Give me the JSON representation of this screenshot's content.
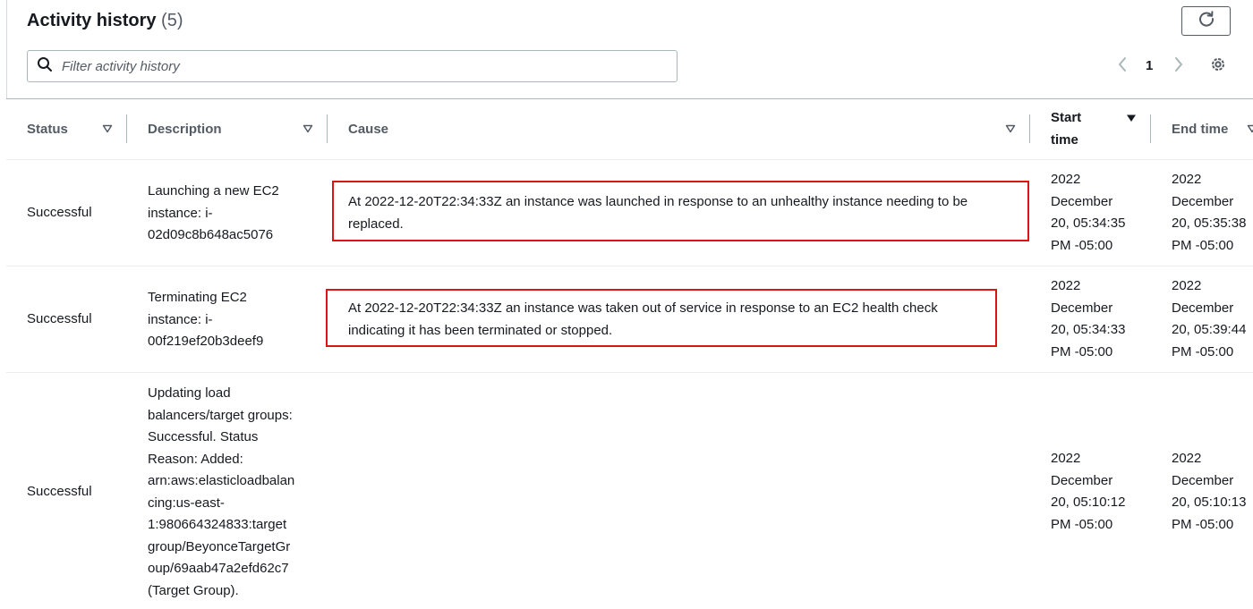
{
  "header": {
    "title": "Activity history",
    "count": "(5)"
  },
  "search": {
    "placeholder": "Filter activity history",
    "value": ""
  },
  "pagination": {
    "current_page": "1"
  },
  "table": {
    "columns": [
      {
        "label": "Status"
      },
      {
        "label": "Description"
      },
      {
        "label": "Cause"
      },
      {
        "label": "Start time",
        "label_lines": [
          "Start",
          "time"
        ]
      },
      {
        "label": "End time"
      }
    ],
    "rows": [
      {
        "status": "Successful",
        "description_lines": [
          "Launching a new EC2",
          "instance: i-",
          "02d09c8b648ac5076"
        ],
        "cause_lines": [
          "At 2022-12-20T22:34:33Z an instance was launched in response to an unhealthy instance needing to be",
          "replaced."
        ],
        "start_lines": [
          "2022",
          "December",
          "20, 05:34:35",
          "PM -05:00"
        ],
        "end_lines": [
          "2022",
          "December",
          "20, 05:35:38",
          "PM -05:00"
        ]
      },
      {
        "status": "Successful",
        "description_lines": [
          "Terminating EC2",
          "instance: i-",
          "00f219ef20b3deef9"
        ],
        "cause_lines": [
          "At 2022-12-20T22:34:33Z an instance was taken out of service in response to an EC2 health check",
          "indicating it has been terminated or stopped."
        ],
        "start_lines": [
          "2022",
          "December",
          "20, 05:34:33",
          "PM -05:00"
        ],
        "end_lines": [
          "2022",
          "December",
          "20, 05:39:44",
          "PM -05:00"
        ]
      },
      {
        "status": "Successful",
        "description_lines": [
          "Updating load",
          "balancers/target groups:",
          "Successful. Status",
          "Reason: Added:",
          "arn:aws:elasticloadbalan",
          "cing:us-east-",
          "1:980664324833:target",
          "group/BeyonceTargetGr",
          "oup/69aab47a2efd62c7",
          "(Target Group)."
        ],
        "cause_lines": [],
        "start_lines": [
          "2022",
          "December",
          "20, 05:10:12",
          "PM -05:00"
        ],
        "end_lines": [
          "2022",
          "December",
          "20, 05:10:13",
          "PM -05:00"
        ]
      }
    ]
  },
  "colors": {
    "highlight_border": "#d91515",
    "text": "#16191f",
    "muted": "#545b64"
  },
  "icons": [
    "refresh-icon",
    "search-icon",
    "chevron-left-icon",
    "chevron-right-icon",
    "settings-gear-icon",
    "filter-caret-icon",
    "sort-descending-icon"
  ]
}
